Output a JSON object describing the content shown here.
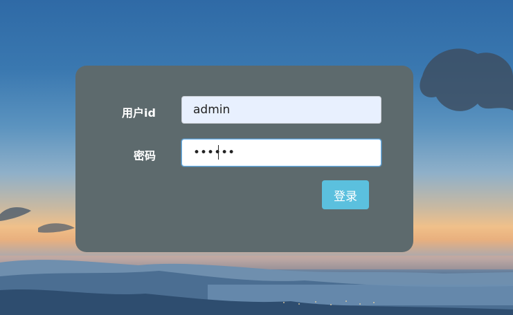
{
  "login_form": {
    "username_label": "用户id",
    "username_value": "admin",
    "password_label": "密码",
    "password_value": "••••••",
    "submit_label": "登录"
  },
  "colors": {
    "panel": "#5d6a6d",
    "username_input_bg": "#e8f0fe",
    "button": "#5bc0de"
  }
}
